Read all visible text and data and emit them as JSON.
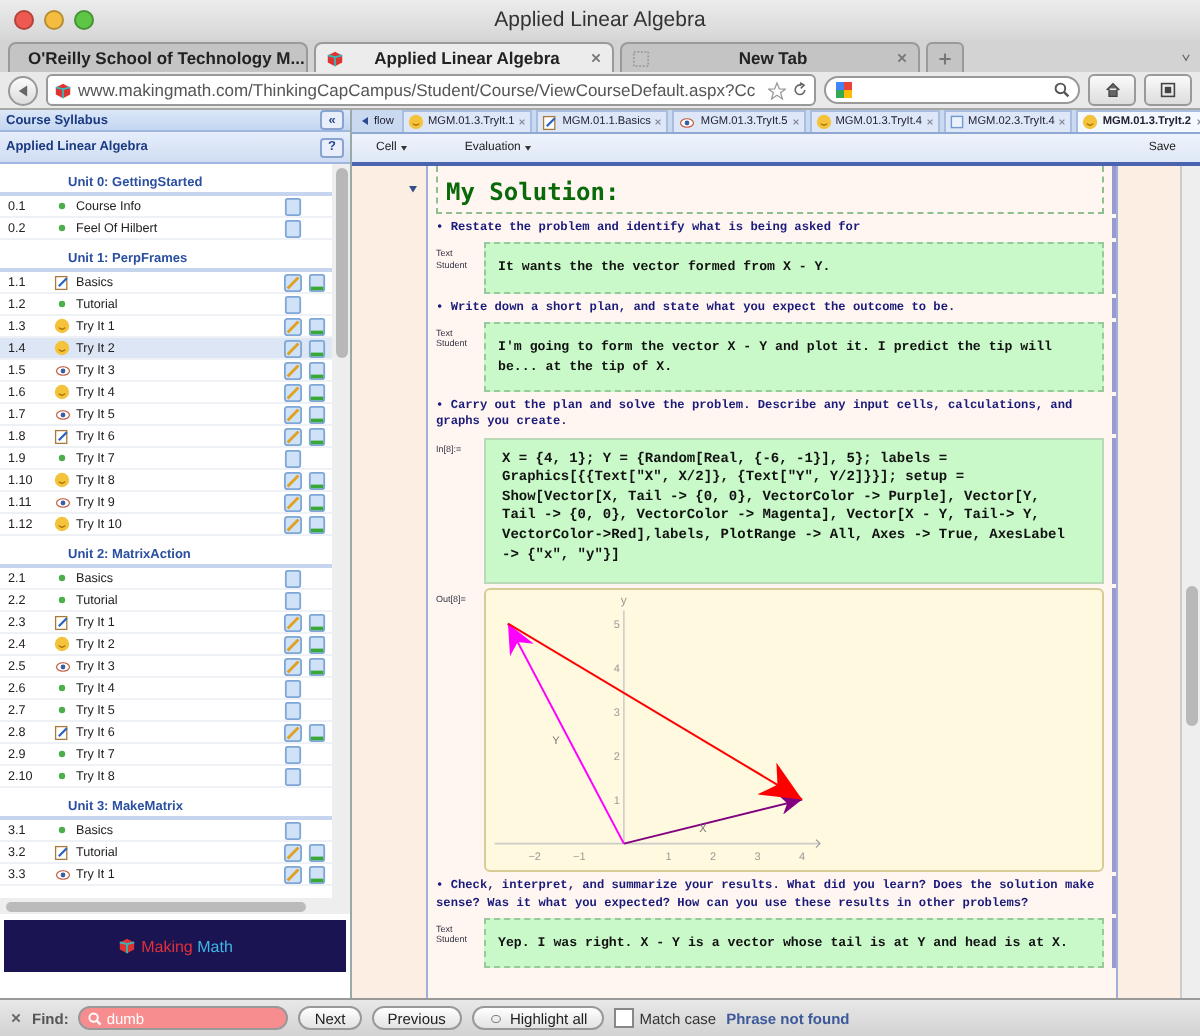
{
  "window": {
    "title": "Applied Linear Algebra"
  },
  "browser_tabs": [
    {
      "label": "O'Reilly School of Technology M...",
      "kind": "mail",
      "selected": false
    },
    {
      "label": "Applied Linear Algebra",
      "kind": "site",
      "selected": true
    },
    {
      "label": "New Tab",
      "kind": "blank",
      "selected": false
    }
  ],
  "address_bar": {
    "url": "www.makingmath.com/ThinkingCapCampus/Student/Course/ViewCourseDefault.aspx?Cc"
  },
  "sidebar": {
    "header": "Course Syllabus",
    "collapse": "«",
    "course": "Applied Linear Algebra",
    "help": "?",
    "units": [
      {
        "title": "Unit 0: GettingStarted",
        "items": [
          {
            "number": "0.1",
            "label": "Course Info",
            "kind": "dot",
            "graded": false,
            "selected": false
          },
          {
            "number": "0.2",
            "label": "Feel Of Hilbert",
            "kind": "dot",
            "graded": false,
            "selected": false
          }
        ]
      },
      {
        "title": "Unit 1: PerpFrames",
        "items": [
          {
            "number": "1.1",
            "label": "Basics",
            "kind": "page",
            "graded": true,
            "selected": false
          },
          {
            "number": "1.2",
            "label": "Tutorial",
            "kind": "dot",
            "graded": false,
            "selected": false
          },
          {
            "number": "1.3",
            "label": "Try It 1",
            "kind": "smiley",
            "graded": true,
            "selected": false
          },
          {
            "number": "1.4",
            "label": "Try It 2",
            "kind": "smiley",
            "graded": true,
            "selected": true
          },
          {
            "number": "1.5",
            "label": "Try It 3",
            "kind": "eye",
            "graded": true,
            "selected": false
          },
          {
            "number": "1.6",
            "label": "Try It 4",
            "kind": "smiley",
            "graded": true,
            "selected": false
          },
          {
            "number": "1.7",
            "label": "Try It 5",
            "kind": "eye",
            "graded": true,
            "selected": false
          },
          {
            "number": "1.8",
            "label": "Try It 6",
            "kind": "page",
            "graded": true,
            "selected": false
          },
          {
            "number": "1.9",
            "label": "Try It 7",
            "kind": "dot",
            "graded": false,
            "selected": false
          },
          {
            "number": "1.10",
            "label": "Try It 8",
            "kind": "smiley",
            "graded": true,
            "selected": false
          },
          {
            "number": "1.11",
            "label": "Try It 9",
            "kind": "eye",
            "graded": true,
            "selected": false
          },
          {
            "number": "1.12",
            "label": "Try It 10",
            "kind": "smiley",
            "graded": true,
            "selected": false
          }
        ]
      },
      {
        "title": "Unit 2: MatrixAction",
        "items": [
          {
            "number": "2.1",
            "label": "Basics",
            "kind": "dot",
            "graded": false,
            "selected": false
          },
          {
            "number": "2.2",
            "label": "Tutorial",
            "kind": "dot",
            "graded": false,
            "selected": false
          },
          {
            "number": "2.3",
            "label": "Try It 1",
            "kind": "page",
            "graded": true,
            "selected": false
          },
          {
            "number": "2.4",
            "label": "Try It 2",
            "kind": "smiley",
            "graded": true,
            "selected": false
          },
          {
            "number": "2.5",
            "label": "Try It 3",
            "kind": "eye",
            "graded": true,
            "selected": false
          },
          {
            "number": "2.6",
            "label": "Try It 4",
            "kind": "dot",
            "graded": false,
            "selected": false
          },
          {
            "number": "2.7",
            "label": "Try It 5",
            "kind": "dot",
            "graded": false,
            "selected": false
          },
          {
            "number": "2.8",
            "label": "Try It 6",
            "kind": "page",
            "graded": true,
            "selected": false
          },
          {
            "number": "2.9",
            "label": "Try It 7",
            "kind": "dot",
            "graded": false,
            "selected": false
          },
          {
            "number": "2.10",
            "label": "Try It 8",
            "kind": "dot",
            "graded": false,
            "selected": false
          }
        ]
      },
      {
        "title": "Unit 3: MakeMatrix",
        "items": [
          {
            "number": "3.1",
            "label": "Basics",
            "kind": "dot",
            "graded": false,
            "selected": false
          },
          {
            "number": "3.2",
            "label": "Tutorial",
            "kind": "page",
            "graded": true,
            "selected": false
          },
          {
            "number": "3.3",
            "label": "Try It 1",
            "kind": "eye",
            "graded": true,
            "selected": false
          }
        ]
      }
    ],
    "logo": {
      "words": [
        "Making",
        "Math"
      ]
    }
  },
  "notebook_tabs": {
    "lead": "flow",
    "tabs": [
      {
        "label": "MGM.01.3.TryIt.1",
        "kind": "smiley",
        "selected": false
      },
      {
        "label": "MGM.01.1.Basics",
        "kind": "page",
        "selected": false
      },
      {
        "label": "MGM.01.3.TryIt.5",
        "kind": "eye",
        "selected": false
      },
      {
        "label": "MGM.01.3.TryIt.4",
        "kind": "smiley",
        "selected": false
      },
      {
        "label": "MGM.02.3.TryIt.4",
        "kind": "doc",
        "selected": false
      },
      {
        "label": "MGM.01.3.TryIt.2",
        "kind": "smiley",
        "selected": true
      }
    ]
  },
  "toolbar": {
    "menus": [
      "Cell",
      "Evaluation"
    ],
    "save": "Save"
  },
  "cells": [
    {
      "kind": "heading",
      "text": "My Solution:"
    },
    {
      "kind": "prompt",
      "text": "• Restate the problem and identify what is being asked for"
    },
    {
      "kind": "answer",
      "label": "Text Student",
      "text": "It wants the the vector formed from X - Y."
    },
    {
      "kind": "prompt",
      "text": "• Write down a short plan, and state what you expect the outcome to be."
    },
    {
      "kind": "answer",
      "label": "Text Student",
      "text": "I'm going to form the vector X - Y and plot it. I predict the tip will be... at the tip of X."
    },
    {
      "kind": "prompt",
      "text": "• Carry out the plan and solve the problem. Describe any input cells, calculations, and graphs you create."
    },
    {
      "kind": "input",
      "label": "In[8]:=",
      "text": "X = {4, 1}; Y = {Random[Real, {-6, -1}], 5}; labels = Graphics[{{Text[\"X\", X/2]}, {Text[\"Y\", Y/2]}}]; setup = Show[Vector[X, Tail -> {0, 0}, VectorColor -> Purple], Vector[Y, Tail -> {0, 0}, VectorColor -> Magenta], Vector[X - Y, Tail-> Y, VectorColor->Red],labels, PlotRange -> All, Axes -> True, AxesLabel -> {\"x\", \"y\"}]"
    },
    {
      "kind": "output",
      "label": "Out[8]=",
      "chart_data": {
        "type": "line",
        "ylabel": "y",
        "xlim": [
          -2.9,
          4.4
        ],
        "ylim": [
          0,
          5.3
        ],
        "xticks": [
          -2,
          -1,
          1,
          2,
          3,
          4
        ],
        "yticks": [
          1,
          2,
          3,
          4,
          5
        ],
        "series": [
          {
            "name": "X",
            "color": "#800080",
            "x": [
              0,
              4
            ],
            "values": [
              0,
              1
            ]
          },
          {
            "name": "Y",
            "color": "#ff00ff",
            "x": [
              0,
              -2.6
            ],
            "values": [
              0,
              5
            ]
          },
          {
            "color": "#ff0000",
            "x": [
              -2.6,
              4
            ],
            "values": [
              5,
              1
            ]
          }
        ]
      }
    },
    {
      "kind": "prompt",
      "text": "• Check, interpret, and summarize your results. What did you learn? Does the solution make sense? Was it what you expected? How can you use these results in other problems?"
    },
    {
      "kind": "answer",
      "label": "Text Student",
      "text": "Yep. I was right. X - Y is a vector whose tail is at Y and head is at X."
    }
  ],
  "find_bar": {
    "label": "Find:",
    "query": "dumb",
    "not_found": true,
    "buttons": [
      "Next",
      "Previous"
    ],
    "highlight_all": "Highlight all",
    "match_case": {
      "label": "Match case",
      "checked": false
    },
    "status": "Phrase not found"
  }
}
